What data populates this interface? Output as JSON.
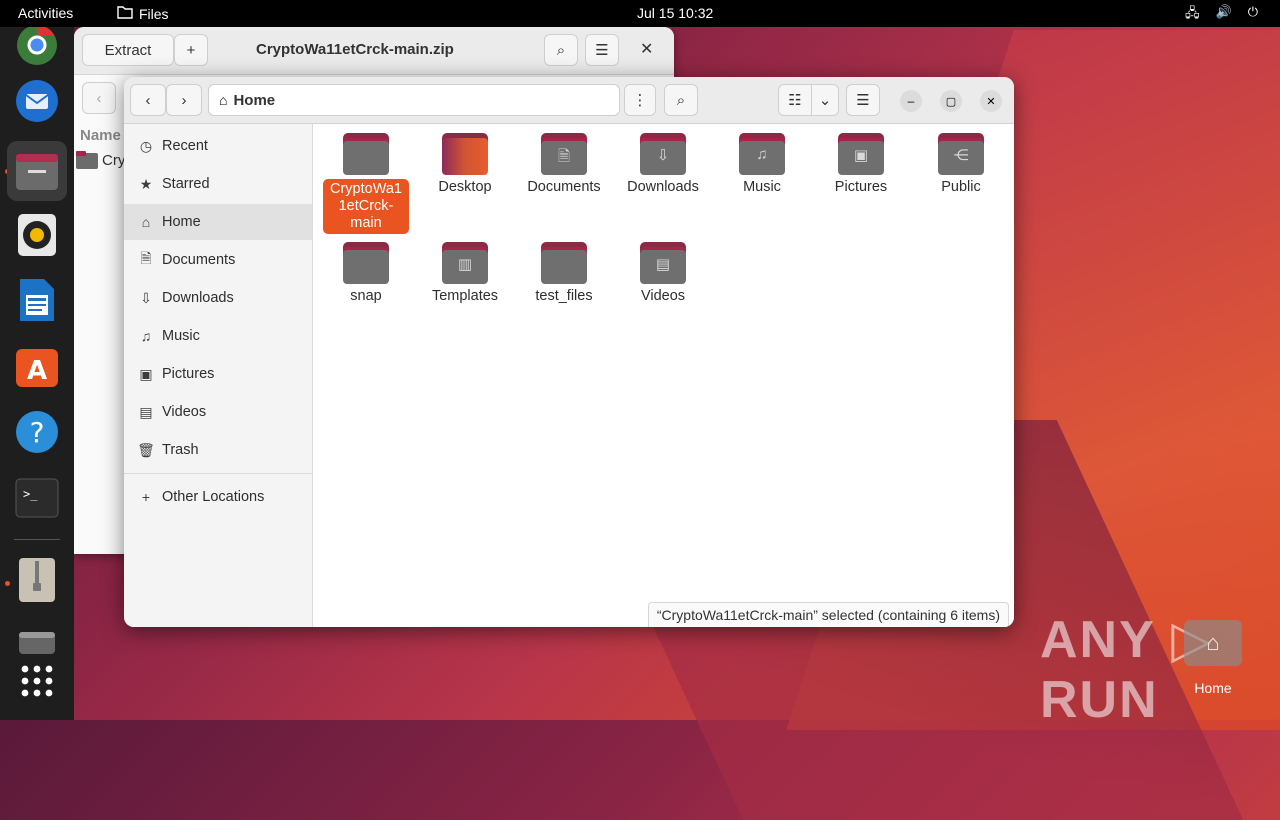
{
  "topbar": {
    "activities": "Activities",
    "app_name": "Files",
    "clock": "Jul 15  10:32"
  },
  "dock": {
    "items": [
      "chrome-icon",
      "thunderbird-icon",
      "files-icon",
      "rhythmbox-icon",
      "writer-icon",
      "software-icon",
      "help-icon",
      "terminal-icon",
      "archive-icon",
      "disk-icon",
      "apps-grid-icon"
    ]
  },
  "archive_window": {
    "title": "CryptoWa11etCrck-main.zip",
    "extract_label": "Extract",
    "column_name": "Name",
    "row_label": "Cry"
  },
  "files_window": {
    "path_label": "Home",
    "sidebar": [
      {
        "label": "Recent",
        "icon": "clock-icon"
      },
      {
        "label": "Starred",
        "icon": "star-icon"
      },
      {
        "label": "Home",
        "icon": "home-icon"
      },
      {
        "label": "Documents",
        "icon": "document-icon"
      },
      {
        "label": "Downloads",
        "icon": "download-icon"
      },
      {
        "label": "Music",
        "icon": "music-icon"
      },
      {
        "label": "Pictures",
        "icon": "picture-icon"
      },
      {
        "label": "Videos",
        "icon": "video-icon"
      },
      {
        "label": "Trash",
        "icon": "trash-icon"
      },
      {
        "label": "Other Locations",
        "icon": "plus-icon"
      }
    ],
    "items": [
      {
        "label": "CryptoWa1\n1etCrck-\nmain",
        "selected": true
      },
      {
        "label": "Desktop"
      },
      {
        "label": "Documents"
      },
      {
        "label": "Downloads"
      },
      {
        "label": "Music"
      },
      {
        "label": "Pictures"
      },
      {
        "label": "Public"
      },
      {
        "label": "snap"
      },
      {
        "label": "Templates"
      },
      {
        "label": "test_files"
      },
      {
        "label": "Videos"
      }
    ],
    "status": "“CryptoWa11etCrck-main” selected  (containing 6 items)"
  },
  "desktop": {
    "home_label": "Home",
    "watermark": "ANY ▷ RUN"
  },
  "colors": {
    "accent": "#e95420",
    "topbar": "#000000",
    "dock": "#1e1e1e"
  }
}
